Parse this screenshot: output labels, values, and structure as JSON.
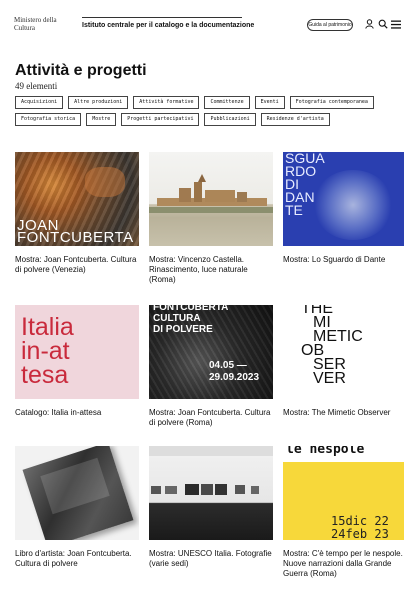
{
  "header": {
    "ministry_line1": "Ministero della",
    "ministry_line2": "Cultura",
    "institute": "Istituto centrale per il catalogo e la documentazione",
    "guide_button": "Guida al patrimonio",
    "icons": [
      "user-icon",
      "search-icon",
      "menu-icon"
    ]
  },
  "page": {
    "title": "Attività e progetti",
    "count": "49 elementi"
  },
  "filters": [
    "Acquisizioni",
    "Altre produzioni",
    "Attività formative",
    "Committenze",
    "Eventi",
    "Fotografia contemporanea",
    "Fotografia storica",
    "Mostre",
    "Progetti partecipativi",
    "Pubblicazioni",
    "Residenze d'artista"
  ],
  "cards": [
    {
      "title": "Mostra: Joan Fontcuberta. Cultura di polvere (Venezia)",
      "overlay": "JOAN FONTCUBERTA"
    },
    {
      "title": "Mostra: Vincenzo Castella. Rinascimento, luce naturale (Roma)"
    },
    {
      "title": "Mostra: Lo Sguardo di Dante",
      "overlay": [
        "SGUA",
        "RDO",
        "DI",
        "DAN",
        "TE"
      ]
    },
    {
      "title": "Catalogo: Italia in-attesa",
      "overlay": [
        "Italia",
        "in-at",
        "tesa"
      ]
    },
    {
      "title": "Mostra: Joan Fontcuberta. Cultura di polvere (Roma)",
      "overlay": [
        "FONTCUBERTA",
        "CULTURA",
        "DI POLVERE",
        "04.05 —",
        "29.09.2023"
      ]
    },
    {
      "title": "Mostra: The Mimetic Observer",
      "overlay": [
        "THE",
        "MI",
        "METIC",
        "OB",
        "SER",
        "VER"
      ]
    },
    {
      "title": "Libro d'artista: Joan Fontcuberta. Cultura di polvere"
    },
    {
      "title": "Mostra: UNESCO Italia. Fotografie (varie sedi)"
    },
    {
      "title": "Mostra: C'è tempo per le nespole. Nuove narrazioni dalla Grande Guerra (Roma)",
      "overlay": [
        "le nespole",
        "15dic 22",
        "24feb 23"
      ]
    }
  ]
}
